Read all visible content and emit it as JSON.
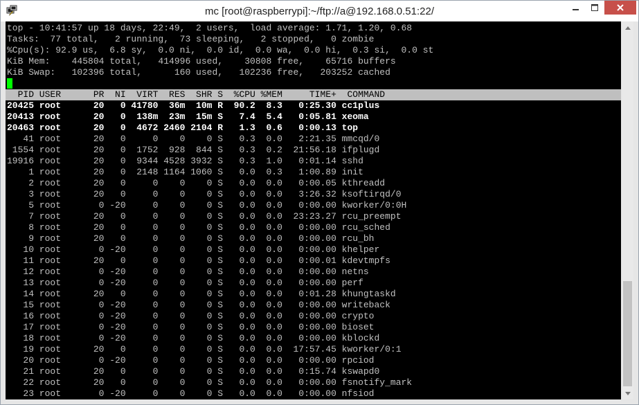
{
  "window": {
    "title": "mc [root@raspberrypi]:~/ftp://a@192.168.0.51:22/",
    "icons": {
      "app": "putty-icon",
      "minimize": "minimize-icon",
      "maximize": "maximize-icon",
      "close": "close-icon"
    },
    "close_color": "#c7504a"
  },
  "summary": {
    "line1": "top - 10:41:57 up 18 days, 22:49,  2 users,  load average: 1.71, 1.20, 0.68",
    "line2": "Tasks:  77 total,   2 running,  73 sleeping,   2 stopped,   0 zombie",
    "line3": "%Cpu(s): 92.9 us,  6.8 sy,  0.0 ni,  0.0 id,  0.0 wa,  0.0 hi,  0.3 si,  0.0 st",
    "line4": "KiB Mem:    445804 total,   414996 used,    30808 free,    65716 buffers",
    "line5": "KiB Swap:   102396 total,      160 used,   102236 free,   203252 cached"
  },
  "table": {
    "header": "  PID USER      PR  NI  VIRT  RES  SHR S  %CPU %MEM     TIME+  COMMAND",
    "rows": [
      "20425 root      20   0 41780  36m  10m R  90.2  8.3   0:25.30 cc1plus",
      "20413 root      20   0  138m  23m  15m S   7.4  5.4   0:05.81 xeoma",
      "20463 root      20   0  4672 2460 2104 R   1.3  0.6   0:00.13 top",
      "   41 root      20   0     0    0    0 S   0.3  0.0   2:21.35 mmcqd/0",
      " 1554 root      20   0  1752  928  844 S   0.3  0.2  21:56.18 ifplugd",
      "19916 root      20   0  9344 4528 3932 S   0.3  1.0   0:01.14 sshd",
      "    1 root      20   0  2148 1164 1060 S   0.0  0.3   1:00.89 init",
      "    2 root      20   0     0    0    0 S   0.0  0.0   0:00.05 kthreadd",
      "    3 root      20   0     0    0    0 S   0.0  0.0   3:26.32 ksoftirqd/0",
      "    5 root       0 -20     0    0    0 S   0.0  0.0   0:00.00 kworker/0:0H",
      "    7 root      20   0     0    0    0 S   0.0  0.0  23:23.27 rcu_preempt",
      "    8 root      20   0     0    0    0 S   0.0  0.0   0:00.00 rcu_sched",
      "    9 root      20   0     0    0    0 S   0.0  0.0   0:00.00 rcu_bh",
      "   10 root       0 -20     0    0    0 S   0.0  0.0   0:00.00 khelper",
      "   11 root      20   0     0    0    0 S   0.0  0.0   0:00.01 kdevtmpfs",
      "   12 root       0 -20     0    0    0 S   0.0  0.0   0:00.00 netns",
      "   13 root       0 -20     0    0    0 S   0.0  0.0   0:00.00 perf",
      "   14 root      20   0     0    0    0 S   0.0  0.0   0:01.28 khungtaskd",
      "   15 root       0 -20     0    0    0 S   0.0  0.0   0:00.00 writeback",
      "   16 root       0 -20     0    0    0 S   0.0  0.0   0:00.00 crypto",
      "   17 root       0 -20     0    0    0 S   0.0  0.0   0:00.00 bioset",
      "   18 root       0 -20     0    0    0 S   0.0  0.0   0:00.00 kblockd",
      "   19 root      20   0     0    0    0 S   0.0  0.0  17:57.45 kworker/0:1",
      "   20 root       0 -20     0    0    0 S   0.0  0.0   0:00.00 rpciod",
      "   21 root      20   0     0    0    0 S   0.0  0.0   0:15.74 kswapd0",
      "   22 root      20   0     0    0    0 S   0.0  0.0   0:00.00 fsnotify_mark",
      "   23 root       0 -20     0    0    0 S   0.0  0.0   0:00.00 nfsiod"
    ],
    "bold_rows": [
      0,
      1,
      2
    ]
  },
  "colors": {
    "terminal_bg": "#000000",
    "terminal_fg": "#c0c0c0",
    "header_bg": "#bfbfbf",
    "cursor": "#00ff00"
  }
}
